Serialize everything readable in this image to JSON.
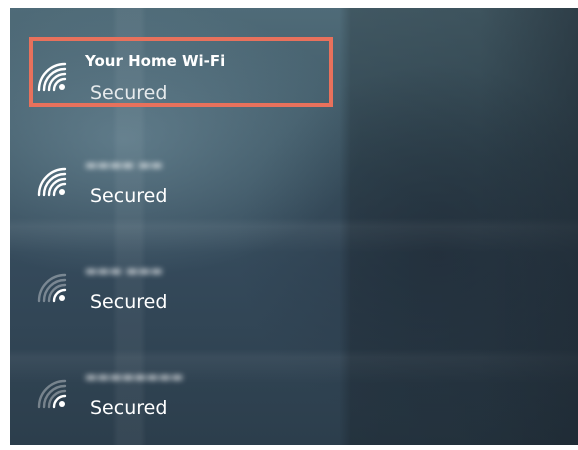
{
  "networks": [
    {
      "name": "Your Home Wi-Fi",
      "status": "Secured",
      "icon": "wifi-icon",
      "signal": "strong"
    },
    {
      "name": "",
      "status": "Secured",
      "icon": "wifi-icon",
      "signal": "strong"
    },
    {
      "name": "",
      "status": "Secured",
      "icon": "wifi-icon",
      "signal": "weak"
    },
    {
      "name": "",
      "status": "Secured",
      "icon": "wifi-icon",
      "signal": "weak"
    }
  ],
  "colors": {
    "highlight": "#e8715c",
    "text": "#ffffff",
    "panel": "#3d5664"
  }
}
